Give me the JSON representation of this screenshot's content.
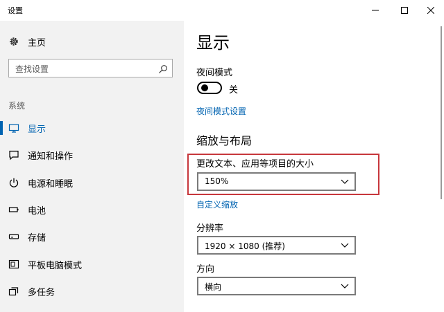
{
  "window": {
    "title": "设置",
    "controls": {
      "minimize": "minimize-icon",
      "maximize": "maximize-icon",
      "close": "close-icon"
    }
  },
  "sidebar": {
    "home": {
      "label": "主页",
      "icon": "gear-icon"
    },
    "search": {
      "placeholder": "查找设置",
      "value": "",
      "icon": "search-icon"
    },
    "section_label": "系统",
    "items": [
      {
        "label": "显示",
        "icon": "monitor-icon",
        "active": true
      },
      {
        "label": "通知和操作",
        "icon": "notification-icon",
        "active": false
      },
      {
        "label": "电源和睡眠",
        "icon": "power-icon",
        "active": false
      },
      {
        "label": "电池",
        "icon": "battery-icon",
        "active": false
      },
      {
        "label": "存储",
        "icon": "storage-icon",
        "active": false
      },
      {
        "label": "平板电脑模式",
        "icon": "tablet-icon",
        "active": false
      },
      {
        "label": "多任务",
        "icon": "multitask-icon",
        "active": false
      }
    ]
  },
  "main": {
    "title": "显示",
    "night_mode": {
      "label": "夜间模式",
      "state": "关",
      "on": false
    },
    "night_mode_link": "夜间模式设置",
    "scale_section": "缩放与布局",
    "scale": {
      "label": "更改文本、应用等项目的大小",
      "value": "150%"
    },
    "custom_scale_link": "自定义缩放",
    "resolution": {
      "label": "分辨率",
      "value": "1920 × 1080 (推荐)"
    },
    "orientation": {
      "label": "方向",
      "value": "横向"
    }
  },
  "colors": {
    "accent": "#0063b1",
    "sidebar_bg": "#f2f2f2",
    "highlight": "#c7373c"
  }
}
